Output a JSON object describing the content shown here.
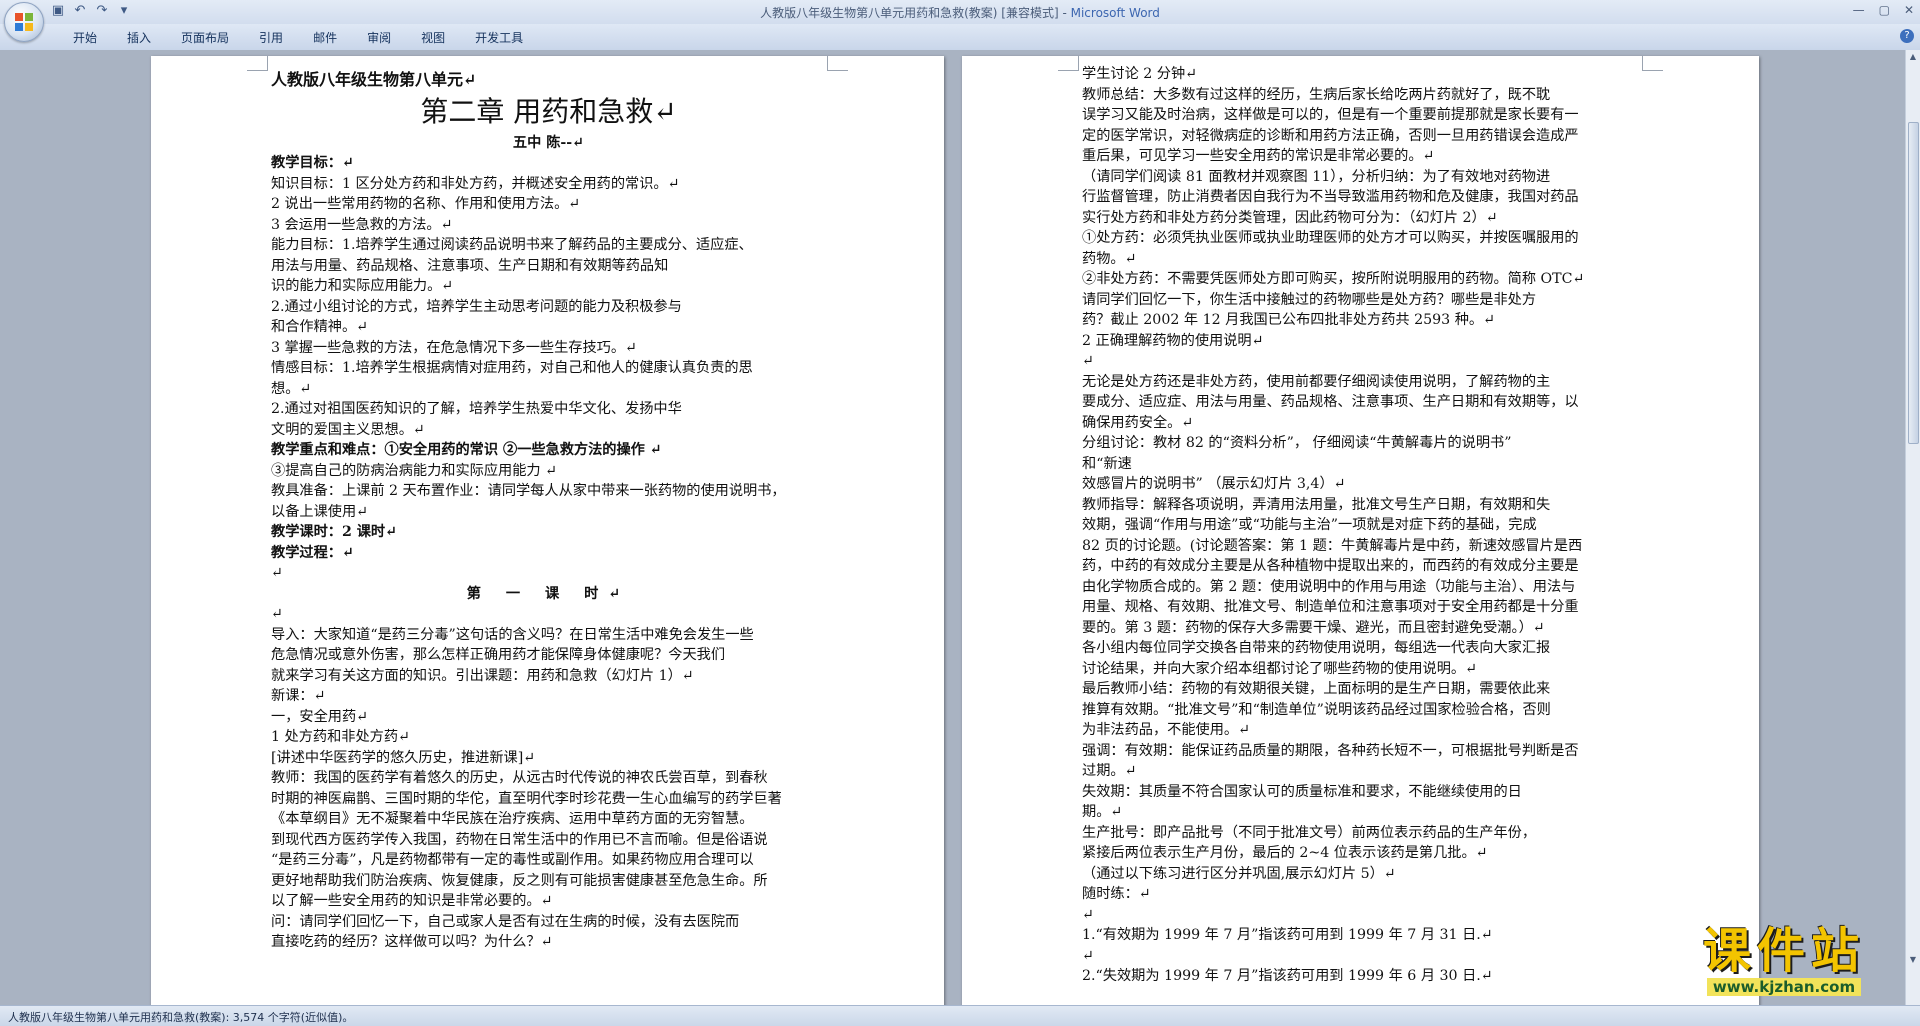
{
  "window": {
    "title_doc": "人教版八年级生物第八单元用药和急救(教案) [兼容模式] - ",
    "title_app": "Microsoft Word"
  },
  "ribbon": {
    "tabs": [
      "开始",
      "插入",
      "页面布局",
      "引用",
      "邮件",
      "审阅",
      "视图",
      "开发工具"
    ]
  },
  "page1": {
    "lines": [
      {
        "t": "人教版八年级生物第八单元↵",
        "cls": "head1"
      },
      {
        "t": "第二章  用药和急救↵",
        "cls": "chapter"
      },
      {
        "t": "五中    陈--↵",
        "cls": "author"
      },
      {
        "t": "教学目标：↵",
        "cls": "b"
      },
      {
        "t": "    知识目标：1 区分处方药和非处方药，并概述安全用药的常识。↵"
      },
      {
        "t": "                          2 说出一些常用药物的名称、作用和使用方法。↵"
      },
      {
        "t": "                          3 会运用一些急救的方法。↵"
      },
      {
        "t": "    能力目标：1.培养学生通过阅读药品说明书来了解药品的主要成分、适应症、"
      },
      {
        "t": "                          用法与用量、药品规格、注意事项、生产日期和有效期等药品知"
      },
      {
        "t": "                          识的能力和实际应用能力。↵"
      },
      {
        "t": "                        2.通过小组讨论的方式，培养学生主动思考问题的能力及积极参与"
      },
      {
        "t": "                          和合作精神。↵"
      },
      {
        "t": "                        3 掌握一些急救的方法，在危急情况下多一些生存技巧。↵"
      },
      {
        "t": "    情感目标：1.培养学生根据病情对症用药，对自己和他人的健康认真负责的思"
      },
      {
        "t": "                          想。↵"
      },
      {
        "t": "                        2.通过对祖国医药知识的了解，培养学生热爱中华文化、发扬中华"
      },
      {
        "t": "                          文明的爱国主义思想。↵"
      },
      {
        "t": "教学重点和难点：①安全用药的常识     ②一些急救方法的操作       ↵",
        "cls": "b"
      },
      {
        "t": "                                ③提高自己的防病治病能力和实际应用能力      ↵"
      },
      {
        "t": "教具准备：上课前 2 天布置作业：请同学每人从家中带来一张药物的使用说明书，"
      },
      {
        "t": "                    以备上课使用↵"
      },
      {
        "t": "教学课时：2 课时↵",
        "cls": "b"
      },
      {
        "t": "教学过程：↵",
        "cls": "b"
      },
      {
        "t": "↵"
      },
      {
        "t": "第  一  课  时↵",
        "cls": "lesson"
      },
      {
        "t": "↵"
      },
      {
        "t": "导入：大家知道“是药三分毒”这句话的含义吗？在日常生活中难免会发生一些"
      },
      {
        "t": "          危急情况或意外伤害，那么怎样正确用药才能保障身体健康呢？今天我们"
      },
      {
        "t": "          就来学习有关这方面的知识。引出课题：用药和急救（幻灯片 1）↵"
      },
      {
        "t": "新课：↵"
      },
      {
        "t": "一，安全用药↵"
      },
      {
        "t": "1 处方药和非处方药↵"
      },
      {
        "t": "        [讲述中华医药学的悠久历史，推进新课]↵"
      },
      {
        "t": "教师：我国的医药学有着悠久的历史，从远古时代传说的神农氏尝百草，到春秋"
      },
      {
        "t": "时期的神医扁鹊、三国时期的华佗，直至明代李时珍花费一生心血编写的药学巨著"
      },
      {
        "t": "《本草纲目》无不凝聚着中华民族在治疗疾病、运用中草药方面的无穷智慧。"
      },
      {
        "t": "到现代西方医药学传入我国，药物在日常生活中的作用已不言而喻。但是俗语说"
      },
      {
        "t": "“是药三分毒”，凡是药物都带有一定的毒性或副作用。如果药物应用合理可以"
      },
      {
        "t": "更好地帮助我们防治疾病、恢复健康，反之则有可能损害健康甚至危急生命。所"
      },
      {
        "t": "以了解一些安全用药的知识是非常必要的。↵"
      },
      {
        "t": "    问：请同学们回忆一下，自己或家人是否有过在生病的时候，没有去医院而"
      },
      {
        "t": "直接吃药的经历？这样做可以吗？为什么？↵"
      }
    ]
  },
  "page2": {
    "lines": [
      {
        "t": "      学生讨论 2 分钟↵"
      },
      {
        "t": "      教师总结：大多数有过这样的经历，生病后家长给吃两片药就好了，既不耽"
      },
      {
        "t": "误学习又能及时治病，这样做是可以的，但是有一个重要前提那就是家长要有一"
      },
      {
        "t": "定的医学常识，对轻微病症的诊断和用药方法正确，否则一旦用药错误会造成严"
      },
      {
        "t": "重后果，可见学习一些安全用药的常识是非常必要的。↵"
      },
      {
        "t": "          （请同学们阅读 81 面教材并观察图 11），分析归纳：为了有效地对药物进"
      },
      {
        "t": "行监督管理，防止消费者因自我行为不当导致滥用药物和危及健康，我国对药品"
      },
      {
        "t": "实行处方药和非处方药分类管理，因此药物可分为：（幻灯片 2）↵"
      },
      {
        "t": "①处方药：必须凭执业医师或执业助理医师的处方才可以购买，并按医嘱服用的"
      },
      {
        "t": "                药物。↵"
      },
      {
        "t": "②非处方药：不需要凭医师处方即可购买，按所附说明服用的药物。简称 OTC↵"
      },
      {
        "t": "    请同学们回忆一下，你生活中接触过的药物哪些是处方药？哪些是非处方"
      },
      {
        "t": "药？截止 2002 年 12 月我国已公布四批非处方药共 2593 种。↵"
      },
      {
        "t": "2 正确理解药物的使用说明↵"
      },
      {
        "t": "↵"
      },
      {
        "t": "      无论是处方药还是非处方药，使用前都要仔细阅读使用说明，了解药物的主"
      },
      {
        "t": "要成分、适应症、用法与用量、药品规格、注意事项、生产日期和有效期等，以"
      },
      {
        "t": "确保用药安全。↵"
      },
      {
        "t": "      分组讨论：教材 82 的“资料分析”，       仔细阅读“牛黄解毒片的说明书”"
      },
      {
        "t": "                                                                                      和“新速"
      },
      {
        "t": "效感冒片的说明书”        （展示幻灯片 3,4）↵"
      },
      {
        "t": "      教师指导：解释各项说明，弄清用法用量，批准文号生产日期，有效期和失"
      },
      {
        "t": "效期，强调“作用与用途”或“功能与主治”一项就是对症下药的基础，完成"
      },
      {
        "t": "82 页的讨论题。(讨论题答案：第 1 题：牛黄解毒片是中药，新速效感冒片是西"
      },
      {
        "t": "药，中药的有效成分主要是从各种植物中提取出来的，而西药的有效成分主要是"
      },
      {
        "t": "由化学物质合成的。第 2 题：使用说明中的作用与用途（功能与主治）、用法与"
      },
      {
        "t": "用量、规格、有效期、批准文号、制造单位和注意事项对于安全用药都是十分重"
      },
      {
        "t": "要的。第 3 题：药物的保存大多需要干燥、避光，而且密封避免受潮。）↵"
      },
      {
        "t": "      各小组内每位同学交换各自带来的药物使用说明，每组选一代表向大家汇报"
      },
      {
        "t": "讨论结果，并向大家介绍本组都讨论了哪些药物的使用说明。↵"
      },
      {
        "t": "      最后教师小结：药物的有效期很关键，上面标明的是生产日期，需要依此来"
      },
      {
        "t": "推算有效期。“批准文号”和“制造单位”说明该药品经过国家检验合格，否则"
      },
      {
        "t": "为非法药品，不能使用。↵"
      },
      {
        "t": "强调：有效期：能保证药品质量的期限，各种药长短不一，可根据批号判断是否"
      },
      {
        "t": "过期。↵"
      },
      {
        "t": "          失效期：其质量不符合国家认可的质量标准和要求，不能继续使用的日"
      },
      {
        "t": "期。↵"
      },
      {
        "t": "          生产批号：即产品批号（不同于批准文号）前两位表示药品的生产年份，"
      },
      {
        "t": "                        紧接后两位表示生产月份，最后的 2~4 位表示该药是第几批。↵"
      },
      {
        "t": "  （通过以下练习进行区分并巩固,展示幻灯片 5）↵"
      },
      {
        "t": "随时练：↵"
      },
      {
        "t": "↵"
      },
      {
        "t": "      1.“有效期为 1999 年 7 月”指该药可用到 1999 年 7 月 31 日.↵"
      },
      {
        "t": "↵"
      },
      {
        "t": "        2.“失效期为 1999 年 7 月”指该药可用到 1999 年 6 月 30 日.↵"
      }
    ]
  },
  "status": {
    "text": "人教版八年级生物第八单元用药和急救(教案): 3,574 个字符(近似值)。"
  },
  "watermark": {
    "title": "课件站",
    "url": "www.kjzhan.com"
  },
  "icons": [
    "office-button-icon",
    "save-icon",
    "undo-icon",
    "redo-icon",
    "customize-qat-icon",
    "minimize-icon",
    "maximize-icon",
    "close-icon",
    "help-icon"
  ]
}
